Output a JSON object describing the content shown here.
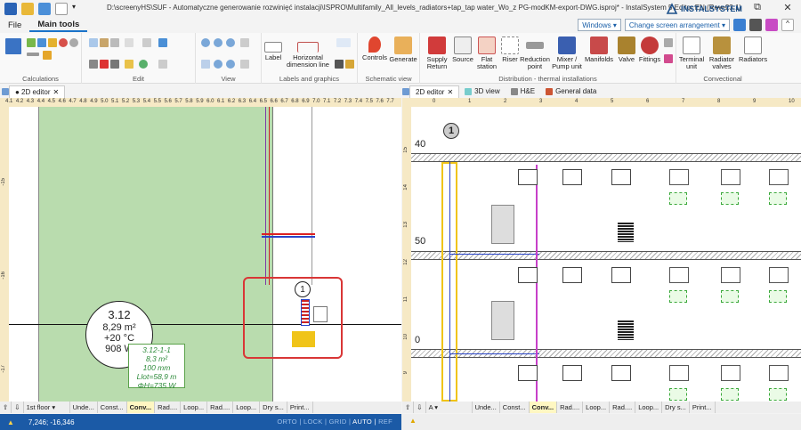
{
  "window": {
    "title": "D:\\screenyHS\\SUF - Automatyczne generowanie rozwinięć instalacji\\ISPRO\\Multifamily_All_levels_radiators+tap_tap water_Wo_z PG-modKM-export-DWG.isproj* - InstalSystem 5 Editor EN (Rev. 23.1)",
    "brand": "INSTALSYSTEM",
    "minimize": "—",
    "restore": "⧉",
    "close": "✕"
  },
  "menu": {
    "file": "File",
    "main_tools": "Main tools",
    "windows_label": "Windows",
    "arrangement_label": "Change screen arrangement"
  },
  "ribbon": {
    "groups": [
      "Calculations",
      "Edit",
      "View",
      "Labels and graphics",
      "Schematic view",
      "Distribution - thermal installations",
      "Convectional"
    ],
    "buttons": {
      "label": "Label",
      "horizontal_dimension": "Horizontal dimension line",
      "controls": "Controls",
      "generate": "Generate",
      "supply_return": "Supply Return",
      "source": "Source",
      "flat_station": "Flat station",
      "riser": "Riser",
      "reduction_point": "Reduction point",
      "mixer_pump": "Mixer / Pump unit",
      "manifolds": "Manifolds",
      "valve": "Valve",
      "fittings": "Fittings",
      "terminal_unit": "Terminal unit",
      "radiator_valves": "Radiator valves",
      "radiators": "Radiators"
    }
  },
  "left_tab": {
    "label": "● 2D editor",
    "close": "✕"
  },
  "right_tabs": [
    {
      "label": "2D editor",
      "close": "✕"
    },
    {
      "label": "3D view"
    },
    {
      "label": "H&E"
    },
    {
      "label": "General data"
    }
  ],
  "left_ruler": {
    "top": [
      "4.1",
      "4.2",
      "4.3",
      "4.4",
      "4.5",
      "4.6",
      "4.7",
      "4.8",
      "4.9",
      "5.0",
      "5.1",
      "5.2",
      "5.3",
      "5.4",
      "5.5",
      "5.6",
      "5.7",
      "5.8",
      "5.9",
      "6.0",
      "6.1",
      "6.2",
      "6.3",
      "6.4",
      "6.5",
      "6.6",
      "6.7",
      "6.8",
      "6.9",
      "7.0",
      "7.1",
      "7.2",
      "7.3",
      "7.4",
      "7.5",
      "7.6",
      "7.7"
    ],
    "left": [
      "-15",
      "-16",
      "-17"
    ]
  },
  "right_ruler": {
    "top": [
      "0",
      "1",
      "2",
      "3",
      "4",
      "5",
      "6",
      "7",
      "8",
      "9",
      "10"
    ],
    "left": [
      "15",
      "14",
      "13",
      "12",
      "11",
      "10",
      "9"
    ]
  },
  "room": {
    "number": "3.12",
    "area": "8,29 m²",
    "temp": "+20 °C",
    "power": "908 W"
  },
  "radiator_label": {
    "id": "3.12-1-1",
    "area": "8,3 m²",
    "size": "100 mm",
    "length": "Llot=58,9 m",
    "power": "ΦH=735 W"
  },
  "marker_number": "1",
  "right_level_labels": [
    "40",
    "50",
    "0"
  ],
  "bottom_tabs_left": {
    "floor": "1st floor",
    "items": [
      "Unde...",
      "Const...",
      "Conv...",
      "Rad....",
      "Loop...",
      "Rad....",
      "Loop...",
      "Dry s...",
      "Print..."
    ],
    "active": "Conv..."
  },
  "bottom_tabs_right": {
    "floor": "A",
    "items": [
      "Unde...",
      "Const...",
      "Conv...",
      "Rad....",
      "Loop...",
      "Rad....",
      "Loop...",
      "Dry s...",
      "Print..."
    ],
    "active": "Conv..."
  },
  "status": {
    "coords": "7,246; -16,346",
    "flags": [
      "ORTO",
      "LOCK",
      "GRID",
      "AUTO",
      "REF"
    ],
    "active_flag": "AUTO"
  },
  "colors": {
    "accent": "#1a73c9",
    "status_bar": "#1b5aa6",
    "green_area": "#b9dcae",
    "highlight_red": "#d93636",
    "riser_yellow": "#f0c419",
    "pipe_magenta": "#c73fc9"
  }
}
